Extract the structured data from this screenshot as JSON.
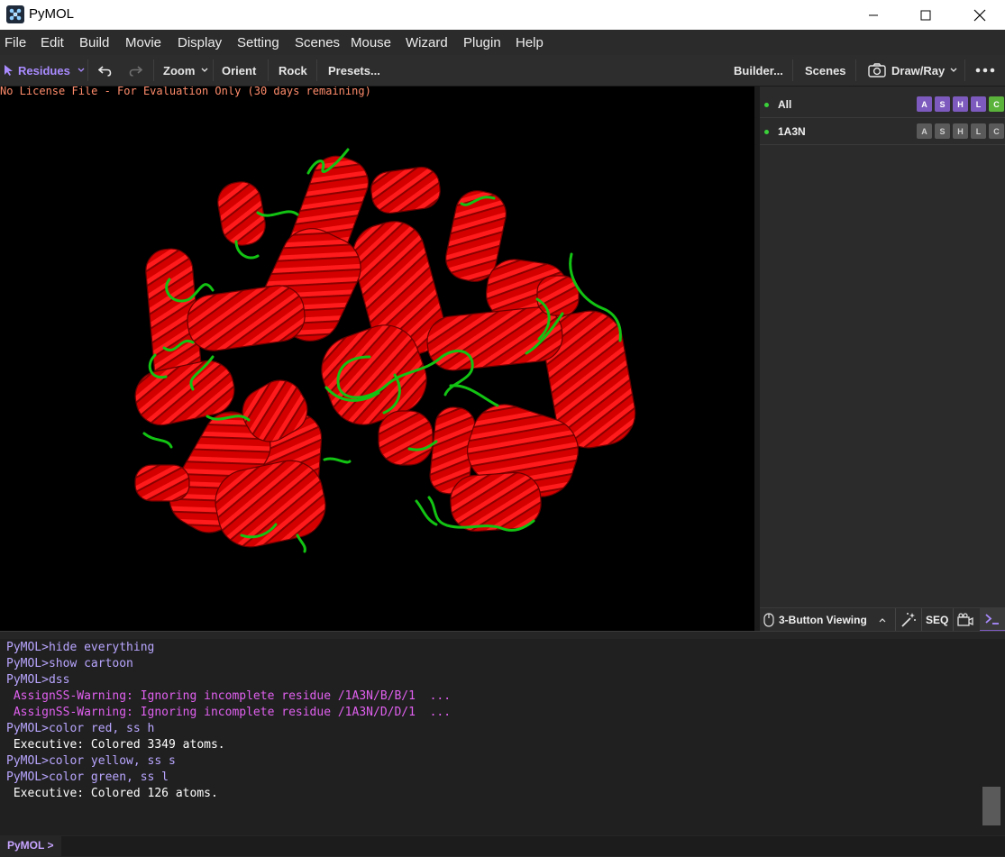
{
  "window": {
    "title": "PyMOL"
  },
  "menu": [
    "File",
    "Edit",
    "Build",
    "Movie",
    "Display",
    "Setting",
    "Scenes",
    "Mouse",
    "Wizard",
    "Plugin",
    "Help"
  ],
  "toolbar": {
    "residues": "Residues",
    "zoom": "Zoom",
    "orient": "Orient",
    "rock": "Rock",
    "presets": "Presets...",
    "builder": "Builder...",
    "scenes": "Scenes",
    "draw_ray": "Draw/Ray"
  },
  "viewport": {
    "license_text": "No License File - For Evaluation Only (30 days remaining)"
  },
  "objects": [
    {
      "name": "All",
      "enabled": true,
      "buttons": [
        "A",
        "S",
        "H",
        "L",
        "C"
      ],
      "button_style": "colored"
    },
    {
      "name": "1A3N",
      "enabled": true,
      "buttons": [
        "A",
        "S",
        "H",
        "L",
        "C"
      ],
      "button_style": "gray"
    }
  ],
  "panel_footer": {
    "mouse_mode": "3-Button Viewing",
    "seq": "SEQ"
  },
  "console": {
    "lines": [
      {
        "text": "PyMOL>hide everything",
        "kind": "cmd"
      },
      {
        "text": "PyMOL>show cartoon",
        "kind": "cmd"
      },
      {
        "text": "PyMOL>dss",
        "kind": "cmd"
      },
      {
        "text": " AssignSS-Warning: Ignoring incomplete residue /1A3N/B/B/1  ...",
        "kind": "warn"
      },
      {
        "text": " AssignSS-Warning: Ignoring incomplete residue /1A3N/D/D/1  ...",
        "kind": "warn"
      },
      {
        "text": "PyMOL>color red, ss h",
        "kind": "cmd"
      },
      {
        "text": " Executive: Colored 3349 atoms.",
        "kind": "out"
      },
      {
        "text": "PyMOL>color yellow, ss s",
        "kind": "cmd"
      },
      {
        "text": "PyMOL>color green, ss l",
        "kind": "cmd"
      },
      {
        "text": " Executive: Colored 126 atoms.",
        "kind": "out"
      }
    ],
    "prompt": "PyMOL >",
    "input_value": ""
  },
  "colors": {
    "helix": "#e00000",
    "loop": "#13c313",
    "cmd_text": "#b9a6ff",
    "warn_text": "#e060ef",
    "out_text": "#ffffff",
    "accent_purple": "#7d5bbe",
    "accent_green": "#5bb33c"
  },
  "icons": [
    "pymol-logo-icon",
    "minimize-icon",
    "maximize-icon",
    "close-icon",
    "pointer-arrow-icon",
    "chevron-down-icon",
    "undo-icon",
    "redo-icon",
    "camera-icon",
    "more-icon",
    "mouse-icon",
    "chevron-up-icon",
    "magic-wand-icon",
    "movie-camera-icon",
    "terminal-icon"
  ]
}
